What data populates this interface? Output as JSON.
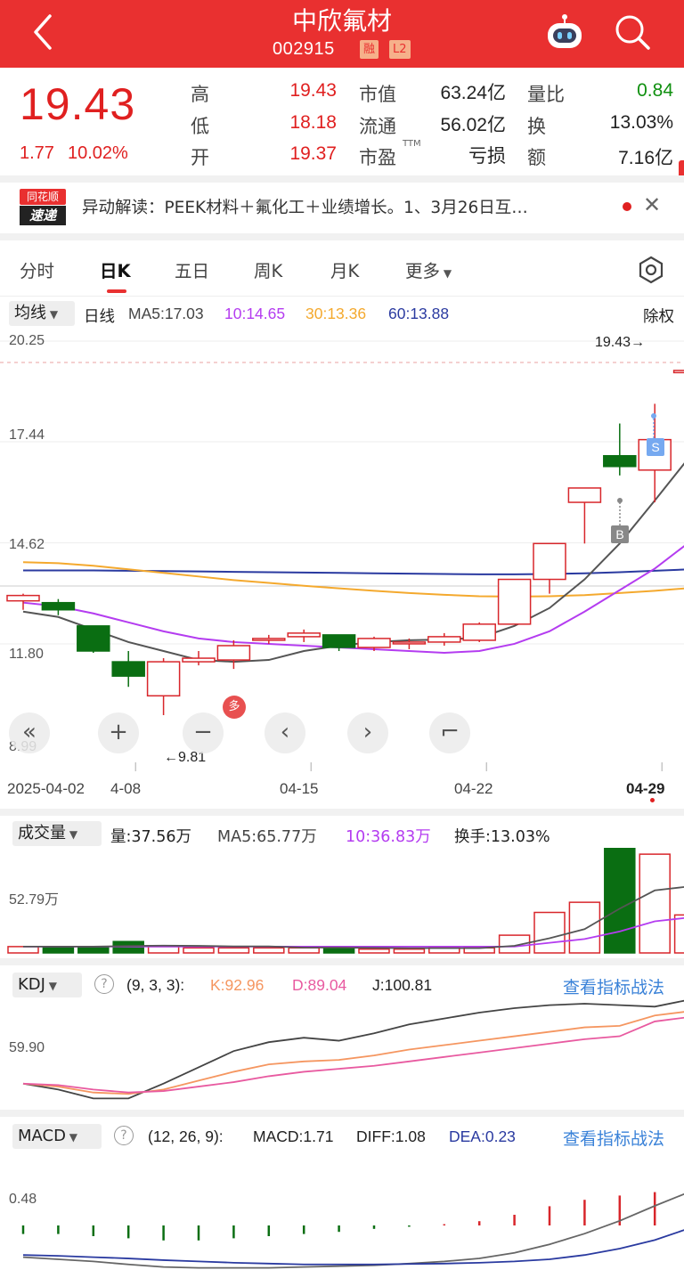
{
  "header": {
    "title": "中欣氟材",
    "code": "002915",
    "tag_margin": "融",
    "tag_level": "L2"
  },
  "quote": {
    "price": "19.43",
    "change": "1.77",
    "change_pct": "10.02%",
    "high_label": "高",
    "high": "19.43",
    "low_label": "低",
    "low": "18.18",
    "open_label": "开",
    "open": "19.37",
    "mcap_label": "市值",
    "mcap": "63.24亿",
    "float_label": "流通",
    "float": "56.02亿",
    "pe_label": "市盈",
    "pe_sup": "TTM",
    "pe": "亏损",
    "vr_label": "量比",
    "vr": "0.84",
    "turnover_label": "换",
    "turnover": "13.03%",
    "amount_label": "额",
    "amount": "7.16亿"
  },
  "news": {
    "logo_top": "同花顺",
    "logo_bottom": "速递",
    "text": "异动解读：PEEK材料＋氟化工＋业绩增长。1、3月26日互…"
  },
  "tabs": [
    "分时",
    "日K",
    "五日",
    "周K",
    "月K",
    "更多"
  ],
  "active_tab": "日K",
  "ma_bar": {
    "selector": "均线",
    "period": "日线",
    "ma5": "MA5:17.03",
    "ma10": "10:14.65",
    "ma30": "30:13.36",
    "ma60": "60:13.88",
    "adjust": "除权"
  },
  "price_axis": [
    "20.25",
    "17.44",
    "14.62",
    "11.80",
    "8.99"
  ],
  "max_label": "19.43→",
  "min_label": "←9.81",
  "date_axis": [
    "2025-04-02",
    "4-08",
    "04-15",
    "04-22",
    "04-29"
  ],
  "marks": {
    "sell": "S",
    "buy": "B",
    "more": "多"
  },
  "controls": [
    "«",
    "+",
    "−",
    "‹",
    "›",
    "⌐"
  ],
  "volume": {
    "selector": "成交量",
    "vol": "量:37.56万",
    "ma5": "MA5:65.77万",
    "ma10": "10:36.83万",
    "turnover": "换手:13.03%",
    "axis": "52.79万"
  },
  "kdj": {
    "selector": "KDJ",
    "params": "(9, 3, 3):",
    "k": "K:92.96",
    "d": "D:89.04",
    "j": "J:100.81",
    "axis": "59.90",
    "link": "查看指标战法"
  },
  "macd": {
    "selector": "MACD",
    "params": "(12, 26, 9):",
    "macd": "MACD:1.71",
    "diff": "DIFF:1.08",
    "dea": "DEA:0.23",
    "axis": "0.48",
    "link": "查看指标战法"
  },
  "chart_data": {
    "type": "candlestick",
    "dates_shown": [
      "2025-04-02",
      "4-08",
      "04-15",
      "04-22",
      "04-29"
    ],
    "ohlc": [
      {
        "o": 13.0,
        "h": 13.2,
        "l": 12.75,
        "c": 13.15
      },
      {
        "o": 12.95,
        "h": 13.05,
        "l": 12.6,
        "c": 12.75
      },
      {
        "o": 12.3,
        "h": 12.3,
        "l": 11.55,
        "c": 11.6
      },
      {
        "o": 11.3,
        "h": 11.6,
        "l": 10.6,
        "c": 10.9
      },
      {
        "o": 10.35,
        "h": 11.4,
        "l": 9.81,
        "c": 11.3
      },
      {
        "o": 11.3,
        "h": 11.6,
        "l": 11.2,
        "c": 11.4
      },
      {
        "o": 11.35,
        "h": 11.9,
        "l": 11.1,
        "c": 11.75
      },
      {
        "o": 11.9,
        "h": 12.05,
        "l": 11.8,
        "c": 11.95
      },
      {
        "o": 12.0,
        "h": 12.2,
        "l": 11.85,
        "c": 12.1
      },
      {
        "o": 12.05,
        "h": 12.05,
        "l": 11.6,
        "c": 11.7
      },
      {
        "o": 11.7,
        "h": 12.0,
        "l": 11.6,
        "c": 11.95
      },
      {
        "o": 11.8,
        "h": 11.95,
        "l": 11.65,
        "c": 11.85
      },
      {
        "o": 11.85,
        "h": 12.1,
        "l": 11.75,
        "c": 12.0
      },
      {
        "o": 11.9,
        "h": 12.4,
        "l": 11.85,
        "c": 12.35
      },
      {
        "o": 12.35,
        "h": 13.6,
        "l": 12.35,
        "c": 13.6
      },
      {
        "o": 13.6,
        "h": 14.6,
        "l": 13.2,
        "c": 14.6
      },
      {
        "o": 15.75,
        "h": 16.15,
        "l": 14.6,
        "c": 16.15
      },
      {
        "o": 17.05,
        "h": 17.95,
        "l": 16.5,
        "c": 16.75
      },
      {
        "o": 16.65,
        "h": 18.5,
        "l": 15.75,
        "c": 17.5
      },
      {
        "o": 19.37,
        "h": 19.43,
        "l": 18.18,
        "c": 19.43
      }
    ],
    "ma5": [
      12.7,
      12.55,
      12.2,
      11.85,
      11.6,
      11.35,
      11.3,
      11.35,
      11.6,
      11.75,
      11.85,
      11.9,
      11.92,
      11.97,
      12.3,
      12.8,
      13.6,
      14.6,
      15.8,
      17.03
    ],
    "ma10": [
      12.95,
      12.85,
      12.65,
      12.4,
      12.15,
      11.95,
      11.85,
      11.8,
      11.75,
      11.7,
      11.65,
      11.6,
      11.55,
      11.6,
      11.8,
      12.15,
      12.7,
      13.3,
      13.9,
      14.65
    ],
    "ma30": [
      14.08,
      14.05,
      13.98,
      13.88,
      13.78,
      13.68,
      13.58,
      13.5,
      13.42,
      13.35,
      13.28,
      13.22,
      13.17,
      13.13,
      13.12,
      13.13,
      13.16,
      13.22,
      13.28,
      13.36
    ],
    "ma60": [
      13.85,
      13.85,
      13.85,
      13.84,
      13.83,
      13.82,
      13.81,
      13.8,
      13.79,
      13.78,
      13.77,
      13.76,
      13.75,
      13.74,
      13.74,
      13.75,
      13.77,
      13.8,
      13.84,
      13.88
    ],
    "volume": [
      5,
      5,
      5,
      9,
      5,
      4,
      4,
      4,
      4,
      5,
      3,
      3,
      4,
      4,
      14,
      32,
      40,
      83,
      78,
      30
    ],
    "vol_ma5": [
      5,
      5,
      5,
      5.5,
      5.8,
      5.6,
      5.2,
      5.2,
      4.2,
      4.2,
      4,
      3.8,
      3.8,
      3.8,
      5.6,
      11.6,
      18.8,
      35,
      49.4,
      52.6
    ],
    "vol_ma10": [
      5,
      5,
      5,
      5,
      5,
      5,
      5,
      5,
      5,
      5,
      5,
      5,
      5,
      5,
      5,
      8,
      11,
      17,
      25,
      28
    ],
    "kdj_k": [
      44,
      42,
      38,
      37,
      40,
      46,
      52,
      57,
      59,
      60,
      63,
      67,
      70,
      73,
      76,
      79,
      82,
      83,
      90,
      92.96
    ],
    "kdj_d": [
      44,
      43,
      40,
      38,
      39,
      42,
      45,
      49,
      52,
      54,
      56,
      59,
      62,
      65,
      68,
      71,
      74,
      76,
      86,
      89.04
    ],
    "kdj_j": [
      44,
      40,
      34,
      34,
      44,
      55,
      66,
      72,
      75,
      73,
      78,
      84,
      88,
      92,
      95,
      97,
      98,
      97,
      96,
      100.81
    ],
    "macd_hist": [
      -0.2,
      -0.2,
      -0.25,
      -0.3,
      -0.35,
      -0.35,
      -0.3,
      -0.25,
      -0.2,
      -0.15,
      -0.08,
      -0.03,
      0.03,
      0.1,
      0.25,
      0.45,
      0.6,
      0.7,
      0.78,
      1.71
    ],
    "diff": [
      -0.45,
      -0.5,
      -0.55,
      -0.62,
      -0.68,
      -0.7,
      -0.7,
      -0.7,
      -0.68,
      -0.66,
      -0.64,
      -0.6,
      -0.55,
      -0.48,
      -0.35,
      -0.15,
      0.1,
      0.4,
      0.75,
      1.08
    ],
    "dea": [
      -0.4,
      -0.42,
      -0.45,
      -0.48,
      -0.52,
      -0.55,
      -0.58,
      -0.6,
      -0.62,
      -0.62,
      -0.62,
      -0.61,
      -0.6,
      -0.58,
      -0.55,
      -0.5,
      -0.4,
      -0.25,
      -0.05,
      0.23
    ],
    "colors": {
      "up": "#d8262b",
      "down": "#0a6e12",
      "ma5": "#555555",
      "ma10": "#b43cf0",
      "ma30": "#f4a92e",
      "ma60": "#2a3aa0",
      "kdj_k": "#f59660",
      "kdj_d": "#e85aa0",
      "kdj_j": "#444444",
      "diff": "#666666",
      "dea": "#2a3aa0"
    },
    "price_range": [
      8.99,
      20.25
    ]
  }
}
